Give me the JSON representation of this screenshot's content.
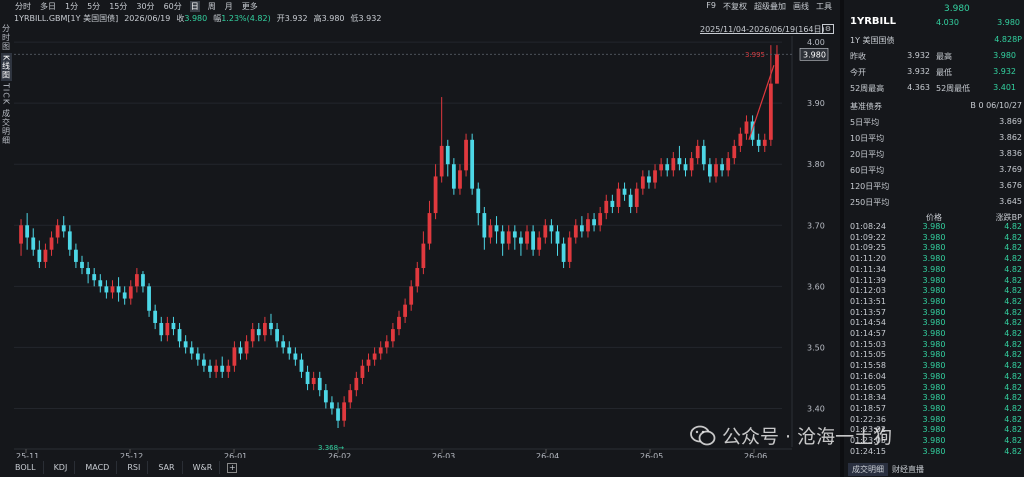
{
  "topbar": {
    "timeframes": [
      "分时",
      "多日",
      "1分",
      "5分",
      "15分",
      "30分",
      "60分",
      "日",
      "周",
      "月",
      "更多"
    ],
    "active_timeframe": "日",
    "right_items": [
      "F9",
      "不复权",
      "超级叠加",
      "画线",
      "工具"
    ]
  },
  "infobar": {
    "symbol": "1YRBILL.GBM[1Y 美国国债]",
    "date": "2026/06/19",
    "close_label": "收",
    "close_value": "3.980",
    "change_label": "幅",
    "change_value": "1.23%(4.82)",
    "open_label": "开",
    "open_value": "3.932",
    "high_label": "高",
    "high_value": "3.980",
    "low_label": "低",
    "low_value": "3.932"
  },
  "leftnav": [
    "分时图",
    "K线图",
    "TICK",
    "成交明细"
  ],
  "leftnav_active": "K线图",
  "chart_range_label": "2025/11/04-2026/06/19(164日)",
  "gear_icon": "gear-icon",
  "chart_data": {
    "type": "candlestick",
    "x_tick_labels": [
      "25-11",
      "25-12",
      "26-01",
      "26-02",
      "26-03",
      "26-04",
      "26-05",
      "26-06"
    ],
    "y_tick_labels": [
      "4.00",
      "3.90",
      "3.80",
      "3.70",
      "3.60",
      "3.50",
      "3.40"
    ],
    "ylim": [
      3.35,
      4.01
    ],
    "current_price_label": "3.980",
    "max_annotation": "3.995",
    "min_annotation": "3.368",
    "up_color": "#e0393e",
    "down_color": "#4dd7e6",
    "candles": [
      [
        3.67,
        3.7,
        3.71,
        3.65
      ],
      [
        3.7,
        3.68,
        3.72,
        3.66
      ],
      [
        3.68,
        3.66,
        3.695,
        3.65
      ],
      [
        3.66,
        3.64,
        3.675,
        3.63
      ],
      [
        3.64,
        3.66,
        3.67,
        3.63
      ],
      [
        3.66,
        3.68,
        3.69,
        3.65
      ],
      [
        3.68,
        3.7,
        3.71,
        3.67
      ],
      [
        3.7,
        3.69,
        3.715,
        3.68
      ],
      [
        3.69,
        3.66,
        3.7,
        3.65
      ],
      [
        3.66,
        3.64,
        3.67,
        3.63
      ],
      [
        3.64,
        3.63,
        3.65,
        3.62
      ],
      [
        3.63,
        3.62,
        3.64,
        3.605
      ],
      [
        3.62,
        3.61,
        3.63,
        3.6
      ],
      [
        3.61,
        3.6,
        3.62,
        3.59
      ],
      [
        3.6,
        3.59,
        3.61,
        3.58
      ],
      [
        3.59,
        3.6,
        3.61,
        3.58
      ],
      [
        3.6,
        3.59,
        3.615,
        3.575
      ],
      [
        3.59,
        3.58,
        3.6,
        3.57
      ],
      [
        3.58,
        3.6,
        3.61,
        3.57
      ],
      [
        3.6,
        3.62,
        3.63,
        3.59
      ],
      [
        3.62,
        3.6,
        3.625,
        3.59
      ],
      [
        3.6,
        3.56,
        3.605,
        3.55
      ],
      [
        3.56,
        3.54,
        3.57,
        3.53
      ],
      [
        3.54,
        3.52,
        3.55,
        3.51
      ],
      [
        3.52,
        3.54,
        3.55,
        3.51
      ],
      [
        3.54,
        3.53,
        3.55,
        3.52
      ],
      [
        3.53,
        3.51,
        3.54,
        3.5
      ],
      [
        3.51,
        3.5,
        3.52,
        3.49
      ],
      [
        3.5,
        3.49,
        3.51,
        3.48
      ],
      [
        3.49,
        3.48,
        3.5,
        3.47
      ],
      [
        3.48,
        3.47,
        3.49,
        3.46
      ],
      [
        3.47,
        3.46,
        3.48,
        3.45
      ],
      [
        3.46,
        3.47,
        3.48,
        3.45
      ],
      [
        3.47,
        3.46,
        3.485,
        3.45
      ],
      [
        3.46,
        3.47,
        3.48,
        3.45
      ],
      [
        3.47,
        3.5,
        3.51,
        3.46
      ],
      [
        3.5,
        3.49,
        3.51,
        3.48
      ],
      [
        3.49,
        3.51,
        3.52,
        3.48
      ],
      [
        3.51,
        3.53,
        3.54,
        3.5
      ],
      [
        3.53,
        3.52,
        3.54,
        3.51
      ],
      [
        3.52,
        3.54,
        3.55,
        3.51
      ],
      [
        3.54,
        3.53,
        3.555,
        3.52
      ],
      [
        3.53,
        3.51,
        3.54,
        3.5
      ],
      [
        3.51,
        3.5,
        3.52,
        3.49
      ],
      [
        3.5,
        3.49,
        3.51,
        3.48
      ],
      [
        3.49,
        3.48,
        3.5,
        3.47
      ],
      [
        3.48,
        3.46,
        3.49,
        3.45
      ],
      [
        3.46,
        3.44,
        3.47,
        3.43
      ],
      [
        3.44,
        3.45,
        3.46,
        3.43
      ],
      [
        3.45,
        3.43,
        3.46,
        3.42
      ],
      [
        3.43,
        3.41,
        3.44,
        3.4
      ],
      [
        3.41,
        3.4,
        3.42,
        3.39
      ],
      [
        3.4,
        3.38,
        3.41,
        3.368
      ],
      [
        3.38,
        3.41,
        3.42,
        3.37
      ],
      [
        3.41,
        3.43,
        3.44,
        3.4
      ],
      [
        3.43,
        3.45,
        3.46,
        3.42
      ],
      [
        3.45,
        3.47,
        3.48,
        3.44
      ],
      [
        3.47,
        3.48,
        3.49,
        3.46
      ],
      [
        3.48,
        3.49,
        3.5,
        3.47
      ],
      [
        3.49,
        3.5,
        3.51,
        3.48
      ],
      [
        3.5,
        3.51,
        3.52,
        3.49
      ],
      [
        3.51,
        3.53,
        3.54,
        3.5
      ],
      [
        3.53,
        3.55,
        3.56,
        3.52
      ],
      [
        3.55,
        3.57,
        3.58,
        3.54
      ],
      [
        3.57,
        3.6,
        3.61,
        3.56
      ],
      [
        3.6,
        3.63,
        3.64,
        3.59
      ],
      [
        3.63,
        3.67,
        3.69,
        3.62
      ],
      [
        3.67,
        3.72,
        3.74,
        3.66
      ],
      [
        3.72,
        3.78,
        3.8,
        3.71
      ],
      [
        3.78,
        3.83,
        3.91,
        3.77
      ],
      [
        3.83,
        3.8,
        3.84,
        3.78
      ],
      [
        3.8,
        3.76,
        3.81,
        3.75
      ],
      [
        3.76,
        3.79,
        3.8,
        3.75
      ],
      [
        3.79,
        3.84,
        3.85,
        3.78
      ],
      [
        3.84,
        3.76,
        3.85,
        3.75
      ],
      [
        3.76,
        3.72,
        3.77,
        3.7
      ],
      [
        3.72,
        3.68,
        3.73,
        3.66
      ],
      [
        3.68,
        3.7,
        3.71,
        3.67
      ],
      [
        3.7,
        3.69,
        3.715,
        3.67
      ],
      [
        3.69,
        3.67,
        3.7,
        3.65
      ],
      [
        3.67,
        3.69,
        3.7,
        3.66
      ],
      [
        3.69,
        3.68,
        3.7,
        3.66
      ],
      [
        3.68,
        3.67,
        3.69,
        3.65
      ],
      [
        3.67,
        3.69,
        3.7,
        3.66
      ],
      [
        3.69,
        3.66,
        3.7,
        3.65
      ],
      [
        3.66,
        3.68,
        3.69,
        3.65
      ],
      [
        3.68,
        3.7,
        3.71,
        3.67
      ],
      [
        3.7,
        3.69,
        3.71,
        3.67
      ],
      [
        3.69,
        3.67,
        3.7,
        3.65
      ],
      [
        3.67,
        3.64,
        3.68,
        3.63
      ],
      [
        3.64,
        3.68,
        3.69,
        3.63
      ],
      [
        3.68,
        3.7,
        3.71,
        3.67
      ],
      [
        3.7,
        3.69,
        3.715,
        3.68
      ],
      [
        3.69,
        3.71,
        3.72,
        3.68
      ],
      [
        3.71,
        3.7,
        3.72,
        3.69
      ],
      [
        3.7,
        3.72,
        3.73,
        3.69
      ],
      [
        3.72,
        3.74,
        3.75,
        3.71
      ],
      [
        3.74,
        3.73,
        3.75,
        3.72
      ],
      [
        3.73,
        3.76,
        3.77,
        3.72
      ],
      [
        3.76,
        3.75,
        3.77,
        3.74
      ],
      [
        3.75,
        3.73,
        3.76,
        3.72
      ],
      [
        3.73,
        3.76,
        3.77,
        3.72
      ],
      [
        3.76,
        3.78,
        3.79,
        3.75
      ],
      [
        3.78,
        3.77,
        3.79,
        3.76
      ],
      [
        3.77,
        3.79,
        3.8,
        3.76
      ],
      [
        3.79,
        3.8,
        3.81,
        3.78
      ],
      [
        3.8,
        3.79,
        3.81,
        3.78
      ],
      [
        3.79,
        3.81,
        3.82,
        3.78
      ],
      [
        3.81,
        3.8,
        3.83,
        3.79
      ],
      [
        3.8,
        3.79,
        3.81,
        3.78
      ],
      [
        3.79,
        3.81,
        3.82,
        3.78
      ],
      [
        3.81,
        3.83,
        3.84,
        3.8
      ],
      [
        3.83,
        3.8,
        3.84,
        3.79
      ],
      [
        3.8,
        3.78,
        3.81,
        3.77
      ],
      [
        3.78,
        3.8,
        3.81,
        3.77
      ],
      [
        3.8,
        3.79,
        3.81,
        3.78
      ],
      [
        3.79,
        3.81,
        3.82,
        3.78
      ],
      [
        3.81,
        3.83,
        3.84,
        3.8
      ],
      [
        3.83,
        3.85,
        3.86,
        3.82
      ],
      [
        3.85,
        3.87,
        3.88,
        3.84
      ],
      [
        3.87,
        3.84,
        3.88,
        3.83
      ],
      [
        3.84,
        3.83,
        3.85,
        3.82
      ],
      [
        3.83,
        3.84,
        3.85,
        3.82
      ],
      [
        3.84,
        3.932,
        3.995,
        3.83
      ],
      [
        3.932,
        3.98,
        3.995,
        3.932
      ]
    ]
  },
  "bottom_tabs": [
    "BOLL",
    "KDJ",
    "MACD",
    "RSI",
    "SAR",
    "W&R"
  ],
  "add_icon": "plus-icon",
  "panel": {
    "symbol": "1YRBILL",
    "price": "3.980",
    "subtitle": "1Y 美国国债",
    "top_values": [
      "4.030",
      "3.980"
    ],
    "bp_change": "4.828P",
    "stats": [
      {
        "k": "昨收",
        "v": "3.932",
        "k2": "最高",
        "v2": "3.980"
      },
      {
        "k": "今开",
        "v": "3.932",
        "k2": "最低",
        "v2": "3.932"
      },
      {
        "k": "52周最高",
        "v": "4.363",
        "k2": "52周最低",
        "v2": "3.401"
      }
    ],
    "benchmark": {
      "k": "基准债券",
      "v": "B 0 06/10/27"
    },
    "averages": [
      {
        "k": "5日平均",
        "v": "3.869"
      },
      {
        "k": "10日平均",
        "v": "3.862"
      },
      {
        "k": "20日平均",
        "v": "3.836"
      },
      {
        "k": "60日平均",
        "v": "3.769"
      },
      {
        "k": "120日平均",
        "v": "3.676"
      },
      {
        "k": "250日平均",
        "v": "3.645"
      }
    ],
    "tick_headers": {
      "price": "价格",
      "bp": "涨跌BP"
    },
    "ticks": [
      {
        "t": "01:08:24",
        "p": "3.980",
        "b": "4.82"
      },
      {
        "t": "01:09:22",
        "p": "3.980",
        "b": "4.82"
      },
      {
        "t": "01:09:25",
        "p": "3.980",
        "b": "4.82"
      },
      {
        "t": "01:11:20",
        "p": "3.980",
        "b": "4.82"
      },
      {
        "t": "01:11:34",
        "p": "3.980",
        "b": "4.82"
      },
      {
        "t": "01:11:39",
        "p": "3.980",
        "b": "4.82"
      },
      {
        "t": "01:12:03",
        "p": "3.980",
        "b": "4.82"
      },
      {
        "t": "01:13:51",
        "p": "3.980",
        "b": "4.82"
      },
      {
        "t": "01:13:57",
        "p": "3.980",
        "b": "4.82"
      },
      {
        "t": "01:14:54",
        "p": "3.980",
        "b": "4.82"
      },
      {
        "t": "01:14:57",
        "p": "3.980",
        "b": "4.82"
      },
      {
        "t": "01:15:03",
        "p": "3.980",
        "b": "4.82"
      },
      {
        "t": "01:15:05",
        "p": "3.980",
        "b": "4.82"
      },
      {
        "t": "01:15:58",
        "p": "3.980",
        "b": "4.82"
      },
      {
        "t": "01:16:04",
        "p": "3.980",
        "b": "4.82"
      },
      {
        "t": "01:16:05",
        "p": "3.980",
        "b": "4.82"
      },
      {
        "t": "01:18:34",
        "p": "3.980",
        "b": "4.82"
      },
      {
        "t": "01:18:57",
        "p": "3.980",
        "b": "4.82"
      },
      {
        "t": "01:22:36",
        "p": "3.980",
        "b": "4.82"
      },
      {
        "t": "01:23:02",
        "p": "3.980",
        "b": "4.82"
      },
      {
        "t": "01:23:05",
        "p": "3.980",
        "b": "4.82"
      },
      {
        "t": "01:24:15",
        "p": "3.980",
        "b": "4.82"
      }
    ],
    "tabs": [
      "成交明细",
      "财经直播"
    ],
    "active_tab": "成交明细"
  },
  "watermark": {
    "icon": "wechat-icon",
    "text": "公众号 · 沧海一土狗"
  }
}
